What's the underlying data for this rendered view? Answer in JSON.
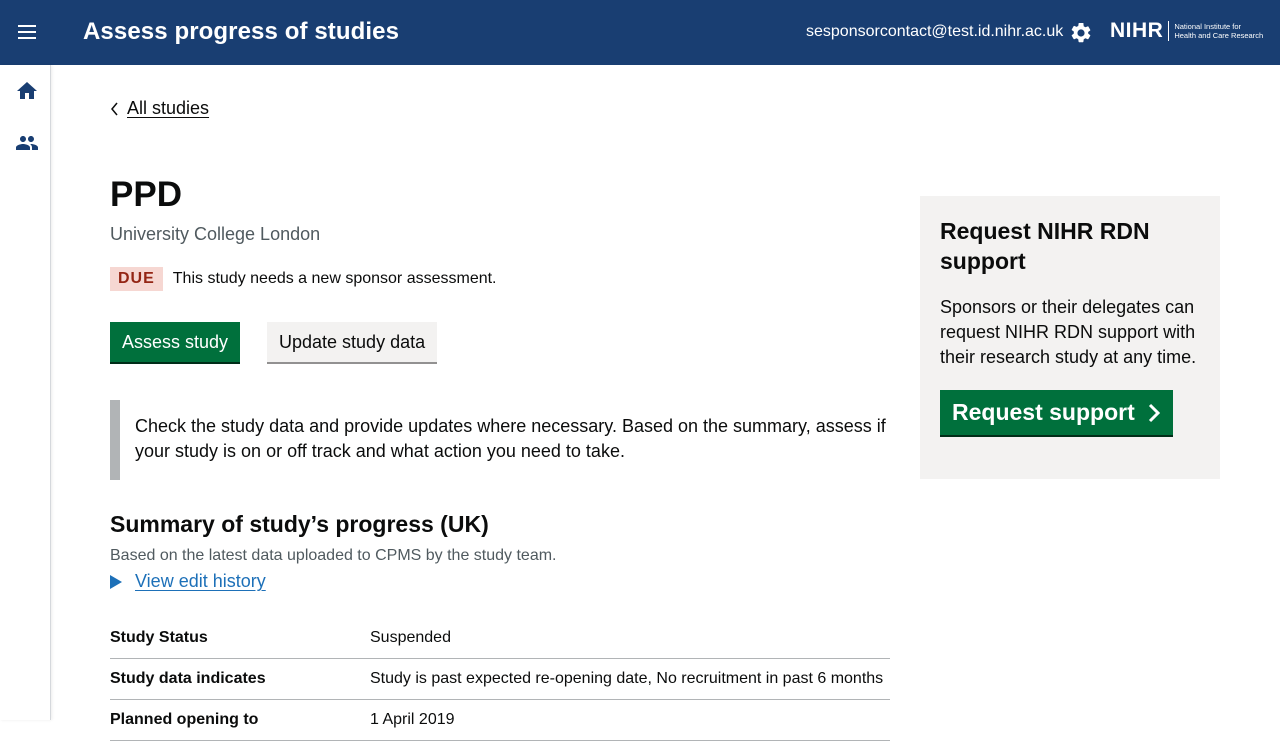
{
  "header": {
    "app_title": "Assess progress of studies",
    "user_email": "sesponsorcontact@test.id.nihr.ac.uk",
    "logo_word": "NIHR",
    "logo_line1": "National Institute for",
    "logo_line2": "Health and Care Research",
    "brand_color": "#193e72",
    "icons": [
      "menu-icon",
      "gear-icon"
    ]
  },
  "sidebar": {
    "items": [
      {
        "icon": "home-icon"
      },
      {
        "icon": "people-icon"
      }
    ]
  },
  "breadcrumb": {
    "back_label": "All studies"
  },
  "study": {
    "title": "PPD",
    "organisation": "University College London",
    "status_badge": "DUE",
    "status_text": "This study needs a new sponsor assessment."
  },
  "actions": {
    "assess_label": "Assess study",
    "update_label": "Update study data"
  },
  "inset_text": "Check the study data and provide updates where necessary. Based on the summary, assess if your study is on or off track and what action you need to take.",
  "summary": {
    "title": "Summary of study’s progress (UK)",
    "subtitle": "Based on the latest data uploaded to CPMS by the study team.",
    "history_link": "View edit history",
    "rows": [
      {
        "key": "Study Status",
        "value": "Suspended"
      },
      {
        "key": "Study data indicates",
        "value": "Study is past expected re-opening date, No recruitment in past 6 months"
      },
      {
        "key": "Planned opening to",
        "value": "1 April 2019"
      }
    ]
  },
  "aside": {
    "title": "Request NIHR RDN support",
    "body": "Sponsors or their delegates can request NIHR RDN support with their research study at any time.",
    "button_label": "Request support"
  }
}
